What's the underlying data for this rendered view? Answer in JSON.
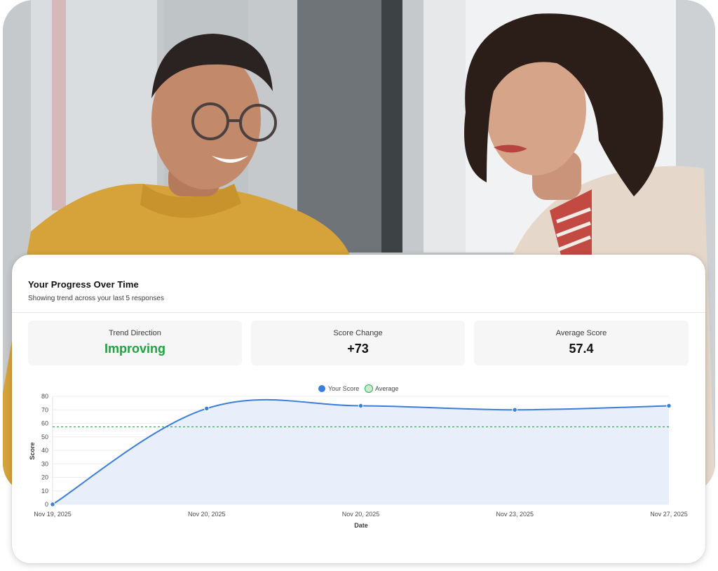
{
  "photo": {
    "description_icon": "photo-icon"
  },
  "card": {
    "title": "Your Progress Over Time",
    "subtitle": "Showing trend across your last 5 responses"
  },
  "stats": [
    {
      "label": "Trend Direction",
      "value": "Improving",
      "color": "#1fa33f"
    },
    {
      "label": "Score Change",
      "value": "+73",
      "color": "#111111"
    },
    {
      "label": "Average Score",
      "value": "57.4",
      "color": "#111111"
    }
  ],
  "colors": {
    "series": "#3b7ddd",
    "series_fill": "#e8effb",
    "average": "#2bb24c",
    "average_fill": "#cfe9d4"
  },
  "chart_data": {
    "type": "line",
    "title": "",
    "xlabel": "Date",
    "ylabel": "Score",
    "categories": [
      "Nov 19, 2025",
      "Nov 20, 2025",
      "Nov 20, 2025",
      "Nov 23, 2025",
      "Nov 27, 2025"
    ],
    "series": [
      {
        "name": "Your Score",
        "values": [
          0,
          71,
          73,
          70,
          73
        ]
      }
    ],
    "average": {
      "name": "Average",
      "value": 57.4
    },
    "ylim": [
      0,
      80
    ],
    "yticks": [
      "0",
      "10",
      "20",
      "30",
      "40",
      "50",
      "60",
      "70",
      "80"
    ],
    "grid": true,
    "legend": "top"
  }
}
